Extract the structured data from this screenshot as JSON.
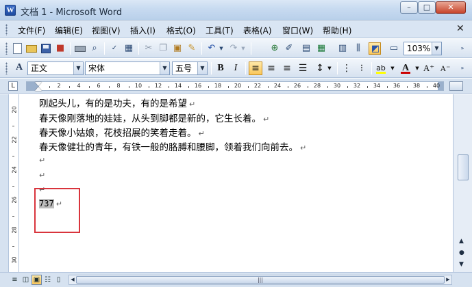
{
  "window": {
    "title": "文档 1 - Microsoft Word",
    "app_icon": "W",
    "controls": {
      "minimize": "–",
      "maximize": "□",
      "close": "✕"
    }
  },
  "menu": {
    "items": [
      {
        "label": "文件(F)"
      },
      {
        "label": "编辑(E)"
      },
      {
        "label": "视图(V)"
      },
      {
        "label": "插入(I)"
      },
      {
        "label": "格式(O)"
      },
      {
        "label": "工具(T)"
      },
      {
        "label": "表格(A)"
      },
      {
        "label": "窗口(W)"
      },
      {
        "label": "帮助(H)"
      }
    ],
    "close_glyph": "✕"
  },
  "standard_toolbar": {
    "icons": [
      "new-document",
      "open-folder",
      "save-disk",
      "permission",
      "print",
      "print-preview",
      "spelling",
      "research",
      "cut",
      "copy",
      "paste",
      "format-painter",
      "undo",
      "redo",
      "hyperlink",
      "tables-borders",
      "insert-table",
      "insert-excel",
      "columns",
      "drawing",
      "document-map",
      "show-hide-marks",
      "read-mode"
    ],
    "zoom": "103%",
    "dropdown_glyph": "▼"
  },
  "formatting_toolbar": {
    "style": "正文",
    "font": "宋体",
    "size": "五号",
    "bold": "B",
    "italic": "I",
    "grow_font": "A⁺",
    "shrink_font": "A⁻",
    "font_color_glyph": "A",
    "highlight_glyph": "ab",
    "font_color": "#cc0000",
    "highlight_color": "#ffff00",
    "active_alignment": "align-left"
  },
  "ruler": {
    "corner": "L",
    "ticks": [
      "2",
      "4",
      "6",
      "8",
      "10",
      "12",
      "14",
      "16",
      "18",
      "20",
      "22",
      "24",
      "26",
      "28",
      "30",
      "32",
      "34",
      "36",
      "38",
      "40"
    ]
  },
  "vertical_ruler": {
    "ticks": [
      "20",
      "22",
      "24",
      "26",
      "28",
      "30"
    ]
  },
  "document": {
    "lines": [
      {
        "text": "刚起头儿，有的是功夫，有的是希望"
      },
      {
        "text": "春天像刚落地的娃娃，从头到脚都是新的，它生长着。"
      },
      {
        "text": "春天像小姑娘，花枝招展的笑着走着。"
      },
      {
        "text": "春天像健壮的青年，有铁一般的胳膊和腰脚，领着我们向前去。"
      },
      {
        "text": ""
      },
      {
        "text": ""
      },
      {
        "text": ""
      }
    ],
    "selected_text": "737",
    "paragraph_mark": "↵",
    "highlight_box_color": "#d9343c"
  },
  "scrollbar": {
    "up": "▲",
    "down": "▼",
    "prev_page": "▲",
    "select_browse": "●",
    "next_page": "▼"
  },
  "bottom": {
    "views": [
      "normal-view",
      "web-layout-view",
      "print-layout-view",
      "outline-view",
      "reading-view"
    ],
    "active_view": "print-layout-view",
    "left_arrow": "◀",
    "right_arrow": "▶",
    "thumb_grip": "|||"
  }
}
